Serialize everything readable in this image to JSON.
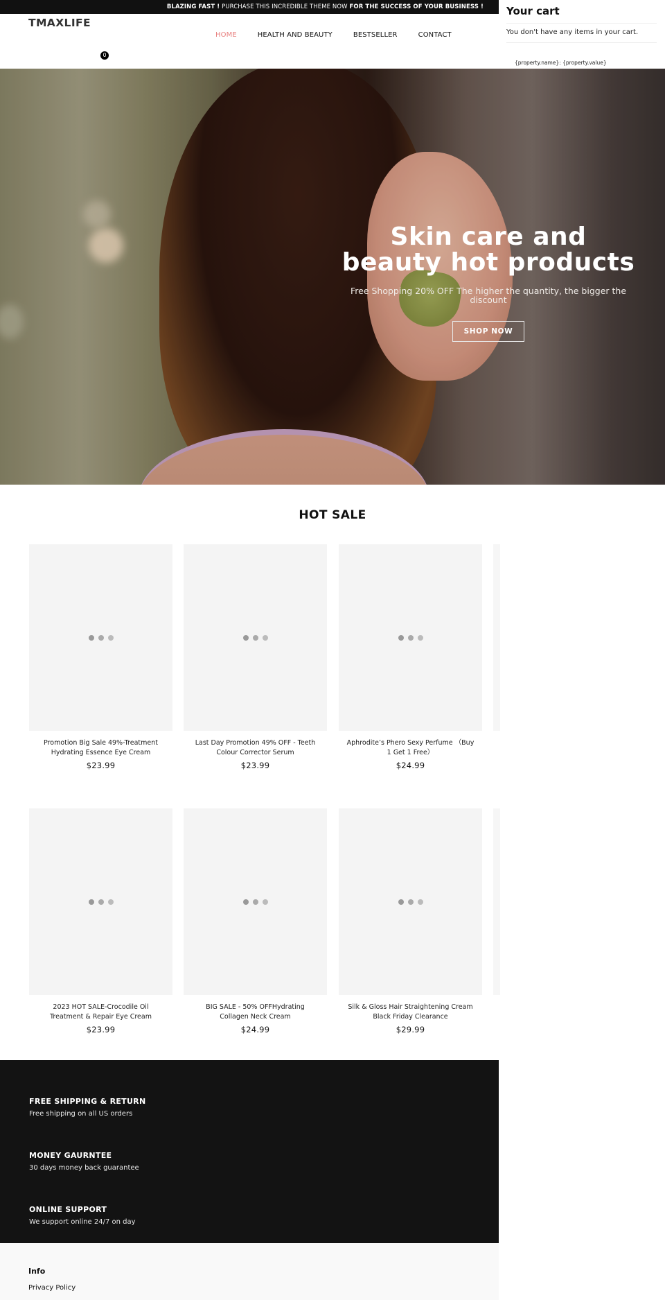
{
  "announcement": {
    "part1_bold": "BLAZING FAST !",
    "part2": " PURCHASE THIS INCREDIBLE THEME NOW ",
    "part3_bold": "FOR THE SUCCESS OF YOUR BUSINESS !"
  },
  "header": {
    "logo": "TMAXLIFE",
    "nav": [
      {
        "label": "HOME",
        "active": true
      },
      {
        "label": "HEALTH AND BEAUTY",
        "active": false
      },
      {
        "label": "BESTSELLER",
        "active": false
      },
      {
        "label": "CONTACT",
        "active": false
      }
    ],
    "cart_count": "0",
    "active_color": "#e8807f"
  },
  "hero": {
    "title_line1": "Skin care and",
    "title_line2": "beauty hot products",
    "subtitle": "Free Shopping 20% OFF The higher the quantity, the bigger the discount",
    "button_label": "SHOP NOW"
  },
  "hot_sale": {
    "title": "HOT SALE",
    "loading_icon": "loading-dots-icon",
    "products": [
      {
        "name": "Promotion Big Sale 49%-Treatment Hydrating Essence Eye Cream",
        "price": "$23.99"
      },
      {
        "name": "Last Day Promotion 49% OFF - Teeth Colour Corrector Serum",
        "price": "$23.99"
      },
      {
        "name": "Aphrodite’s Phero Sexy Perfume （Buy 1 Get 1 Free）",
        "price": "$24.99"
      },
      {
        "name": "2023 HOT SALE-Crocodile Oil Treatment & Repair Eye Cream",
        "price": "$23.99"
      },
      {
        "name": "BIG SALE - 50% OFFHydrating Collagen Neck Cream",
        "price": "$24.99"
      },
      {
        "name": "Silk & Gloss Hair Straightening Cream Black Friday Clearance",
        "price": "$29.99"
      }
    ]
  },
  "features": [
    {
      "title": "FREE SHIPPING & RETURN",
      "desc": "Free shipping on all US orders"
    },
    {
      "title": "MONEY GAURNTEE",
      "desc": "30 days money back guarantee"
    },
    {
      "title": "ONLINE SUPPORT",
      "desc": "We support online 24/7 on day"
    }
  ],
  "footer": {
    "heading": "Info",
    "links": [
      "Privacy Policy"
    ]
  },
  "cart_drawer": {
    "title": "Your cart",
    "empty_message": "You don't have any items in your cart.",
    "property_template": "{property.name}: {property.value}"
  }
}
